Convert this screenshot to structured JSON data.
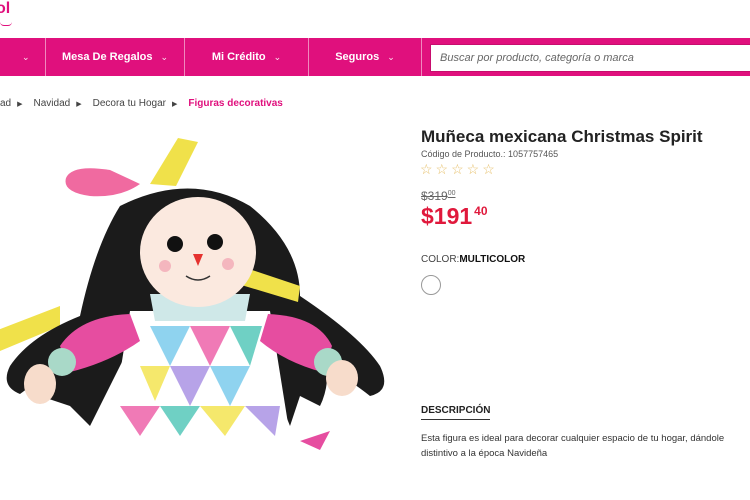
{
  "logo": {
    "text": "ol"
  },
  "nav": {
    "items": [
      {
        "label": ""
      },
      {
        "label": "Mesa De Regalos"
      },
      {
        "label": "Mi Crédito"
      },
      {
        "label": "Seguros"
      }
    ],
    "search_placeholder": "Buscar por producto, categoría o marca"
  },
  "breadcrumb": {
    "items": [
      "ad",
      "Navidad",
      "Decora tu Hogar"
    ],
    "current": "Figuras decorativas"
  },
  "product": {
    "title": "Muñeca mexicana Christmas Spirit",
    "code": "Código de Producto.: 1057757465",
    "rating_stars": "☆☆☆☆☆",
    "rating_value": 0,
    "old_price_main": "$319",
    "old_price_cents": "00",
    "price_main": "$191",
    "price_cents": "40",
    "color_label": "COLOR:",
    "color_value": "MULTICOLOR",
    "description_title": "DESCRIPCIÓN",
    "description": "Esta figura es ideal para decorar cualquier espacio de tu hogar, dándole distintivo a la época Navideña"
  },
  "colors": {
    "brand": "#e0107d",
    "price": "#e0193c",
    "stars": "#e7c16d"
  }
}
